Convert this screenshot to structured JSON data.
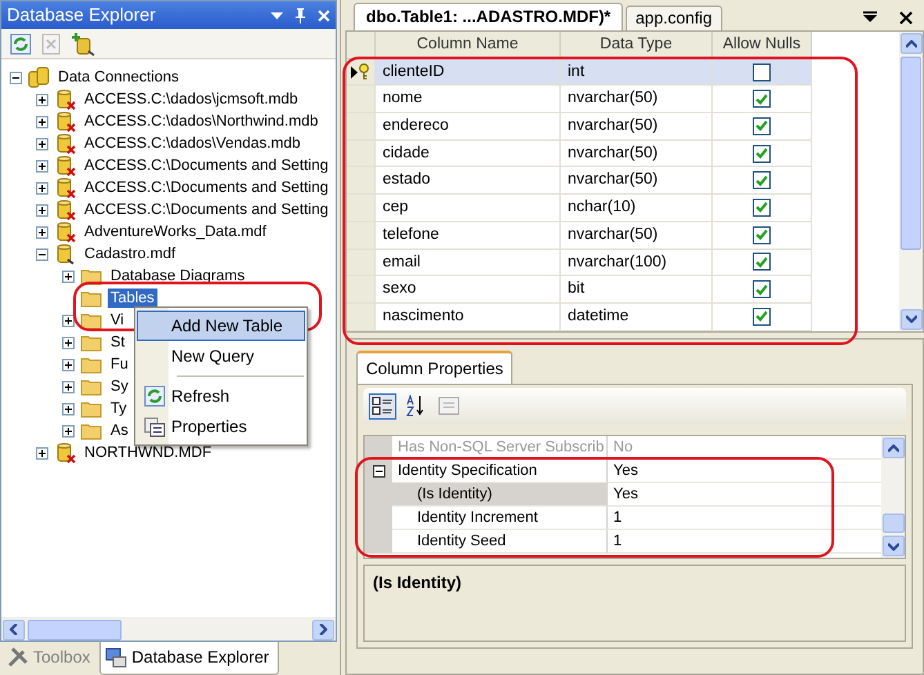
{
  "explorer": {
    "title": "Database Explorer",
    "tree": [
      {
        "label": "Data Connections",
        "kind": "connections",
        "expanded": true,
        "selected": false,
        "children": [
          {
            "label": "ACCESS.C:\\dados\\jcmsoft.mdb",
            "kind": "broken",
            "expanded": false,
            "selected": false
          },
          {
            "label": "ACCESS.C:\\dados\\Northwind.mdb",
            "kind": "broken",
            "expanded": false,
            "selected": false
          },
          {
            "label": "ACCESS.C:\\dados\\Vendas.mdb",
            "kind": "broken",
            "expanded": false,
            "selected": false
          },
          {
            "label": "ACCESS.C:\\Documents and Setting",
            "kind": "broken",
            "expanded": false,
            "selected": false
          },
          {
            "label": "ACCESS.C:\\Documents and Setting",
            "kind": "broken",
            "expanded": false,
            "selected": false
          },
          {
            "label": "ACCESS.C:\\Documents and Setting",
            "kind": "broken",
            "expanded": false,
            "selected": false
          },
          {
            "label": "AdventureWorks_Data.mdf",
            "kind": "broken",
            "expanded": false,
            "selected": false
          },
          {
            "label": "Cadastro.mdf",
            "kind": "connected",
            "expanded": true,
            "selected": false,
            "children": [
              {
                "label": "Database Diagrams",
                "kind": "folder",
                "expanded": false,
                "selected": false
              },
              {
                "label": "Tables",
                "kind": "folder",
                "selected": true
              },
              {
                "label": "Vi",
                "kind": "folder",
                "expanded": false,
                "selected": false
              },
              {
                "label": "St",
                "kind": "folder",
                "expanded": false,
                "selected": false
              },
              {
                "label": "Fu",
                "kind": "folder",
                "expanded": false,
                "selected": false
              },
              {
                "label": "Sy",
                "kind": "folder",
                "expanded": false,
                "selected": false
              },
              {
                "label": "Ty",
                "kind": "folder",
                "expanded": false,
                "selected": false
              },
              {
                "label": "As",
                "kind": "folder",
                "expanded": false,
                "selected": false
              }
            ]
          },
          {
            "label": "NORTHWND.MDF",
            "kind": "broken",
            "expanded": false,
            "selected": false
          }
        ]
      }
    ],
    "bottom_tabs": [
      {
        "label": "Toolbox",
        "kind": "toolbox",
        "selected": false
      },
      {
        "label": "Database Explorer",
        "kind": "explorer",
        "selected": true
      }
    ]
  },
  "context_menu": [
    {
      "kind": "plain",
      "label": "Add New Table",
      "selected": true
    },
    {
      "kind": "plain",
      "label": "New Query",
      "selected": false
    },
    {
      "kind": "separator"
    },
    {
      "kind": "refresh",
      "label": "Refresh",
      "selected": false
    },
    {
      "kind": "properties",
      "label": "Properties",
      "selected": false
    }
  ],
  "document_tabs": [
    {
      "label": "dbo.Table1: ...ADASTRO.MDF)*",
      "selected": true
    },
    {
      "label": "app.config",
      "selected": false
    }
  ],
  "table": {
    "columns": [
      "Column Name",
      "Data Type",
      "Allow Nulls"
    ],
    "rows": [
      {
        "name": "clienteID",
        "type": "int",
        "allow_nulls": false,
        "selected": true,
        "primary_key": true
      },
      {
        "name": "nome",
        "type": "nvarchar(50)",
        "allow_nulls": true,
        "selected": false,
        "primary_key": false
      },
      {
        "name": "endereco",
        "type": "nvarchar(50)",
        "allow_nulls": true,
        "selected": false,
        "primary_key": false
      },
      {
        "name": "cidade",
        "type": "nvarchar(50)",
        "allow_nulls": true,
        "selected": false,
        "primary_key": false
      },
      {
        "name": "estado",
        "type": "nvarchar(50)",
        "allow_nulls": true,
        "selected": false,
        "primary_key": false
      },
      {
        "name": "cep",
        "type": "nchar(10)",
        "allow_nulls": true,
        "selected": false,
        "primary_key": false
      },
      {
        "name": "telefone",
        "type": "nvarchar(50)",
        "allow_nulls": true,
        "selected": false,
        "primary_key": false
      },
      {
        "name": "email",
        "type": "nvarchar(100)",
        "allow_nulls": true,
        "selected": false,
        "primary_key": false
      },
      {
        "name": "sexo",
        "type": "bit",
        "allow_nulls": true,
        "selected": false,
        "primary_key": false
      },
      {
        "name": "nascimento",
        "type": "datetime",
        "allow_nulls": true,
        "selected": false,
        "primary_key": false
      }
    ]
  },
  "column_properties": {
    "tab": "Column Properties",
    "rows": [
      {
        "name": "Has Non-SQL Server Subscrib",
        "value": "No",
        "disabled": true,
        "selected": false
      },
      {
        "name": "Identity Specification",
        "value": "Yes",
        "disabled": false,
        "selected": false,
        "expanded": true,
        "children": [
          {
            "name": "(Is Identity)",
            "value": "Yes",
            "disabled": false,
            "selected": true
          },
          {
            "name": "Identity Increment",
            "value": "1",
            "disabled": false,
            "selected": false
          },
          {
            "name": "Identity Seed",
            "value": "1",
            "disabled": false,
            "selected": false
          }
        ]
      }
    ],
    "description": "(Is Identity)"
  }
}
